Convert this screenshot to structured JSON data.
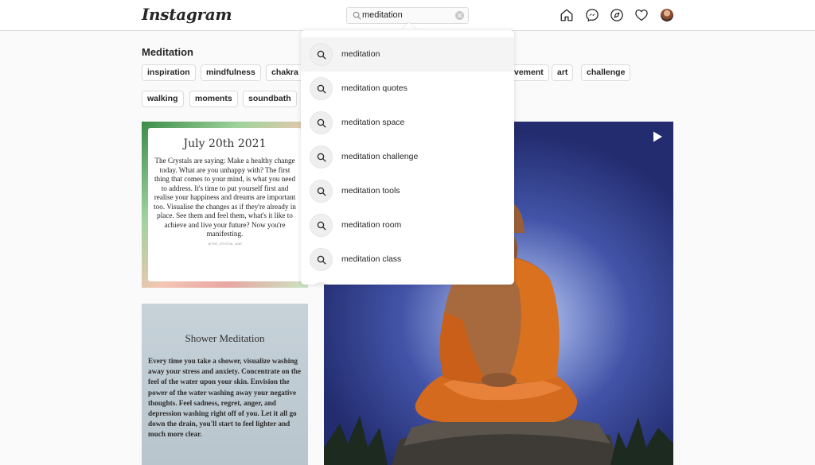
{
  "header": {
    "logo": "Instagram",
    "search_value": "meditation"
  },
  "page": {
    "title": "Meditation",
    "tags_row1": [
      "inspiration",
      "mindfulness",
      "chakra",
      "vement",
      "art",
      "challenge"
    ],
    "tags_row2": [
      "walking",
      "moments",
      "soundbath"
    ]
  },
  "dropdown": {
    "items": [
      "meditation",
      "meditation quotes",
      "meditation space",
      "meditation challenge",
      "meditation tools",
      "meditation room",
      "meditation class"
    ]
  },
  "posts": {
    "crystal": {
      "title": "July 20th 2021",
      "body": "The Crystals are saying: Make a healthy change today. What are you unhappy with? The first thing that comes to your mind, is what you need to address. It's time to put yourself first and realise your happiness and dreams are important too. Visualise the changes as if they're already in place. See them and feel them, what's it like to achieve and live your future? Now you're manifesting.",
      "credit": "@THE_CRYSTAL_BAR"
    },
    "shower": {
      "title": "Shower Meditation",
      "body": "Every time you take a shower, visualize washing away your stress and anxiety. Concentrate on the feel of the water upon your skin. Envision the power of the water washing away your negative thoughts. Feel sadness, regret, anger, and depression washing right off of you. Let it all go down the drain, you'll start to feel lighter and much more clear."
    }
  },
  "icons": [
    "home-icon",
    "messenger-icon",
    "explore-icon",
    "heart-icon",
    "search-icon",
    "play-icon"
  ],
  "colors": {
    "border": "#dbdbdb",
    "background": "#fafafa",
    "text": "#262626"
  }
}
